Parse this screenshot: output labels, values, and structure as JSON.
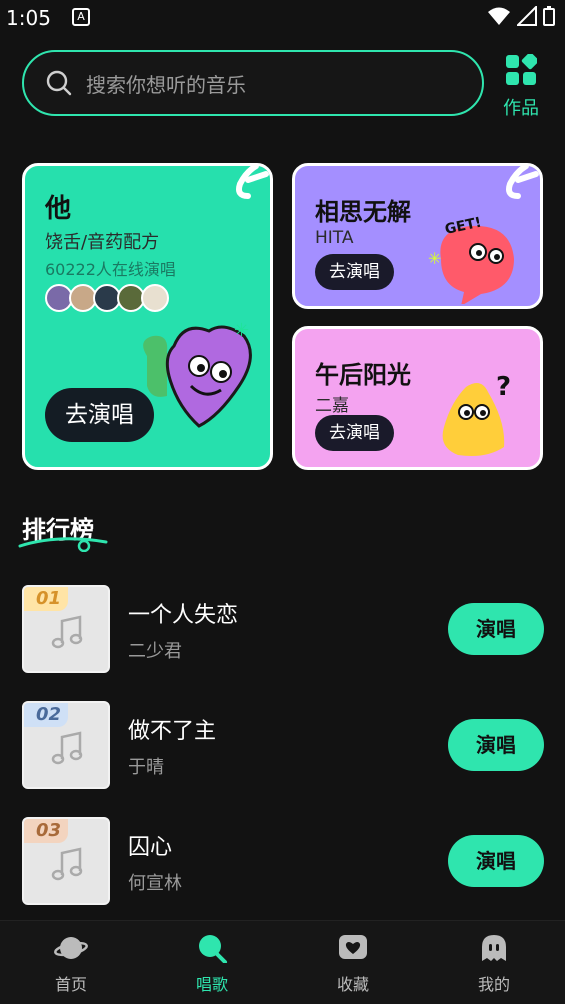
{
  "status": {
    "time": "1:05",
    "badge": "A"
  },
  "search": {
    "placeholder": "搜索你想听的音乐"
  },
  "works": {
    "label": "作品"
  },
  "featured": {
    "big": {
      "title": "他",
      "artist": "饶舌/音药配方",
      "online": "60222人在线演唱",
      "button": "去演唱"
    },
    "purple": {
      "title": "相思无解",
      "artist": "HITA",
      "button": "去演唱"
    },
    "pink": {
      "title": "午后阳光",
      "artist": "二嘉",
      "button": "去演唱"
    }
  },
  "ranking": {
    "title": "排行榜",
    "items": [
      {
        "rank": "01",
        "name": "一个人失恋",
        "artist": "二少君",
        "button": "演唱"
      },
      {
        "rank": "02",
        "name": "做不了主",
        "artist": "于晴",
        "button": "演唱"
      },
      {
        "rank": "03",
        "name": "囚心",
        "artist": "何宣林",
        "button": "演唱"
      }
    ]
  },
  "tabs": [
    {
      "label": "首页",
      "icon": "planet-icon"
    },
    {
      "label": "唱歌",
      "icon": "microphone-icon",
      "active": true
    },
    {
      "label": "收藏",
      "icon": "heart-icon"
    },
    {
      "label": "我的",
      "icon": "ghost-icon"
    }
  ],
  "colors": {
    "accent": "#2fe5ae",
    "background": "#121212",
    "card_green": "#26e0ad",
    "card_purple": "#a48fff",
    "card_pink": "#f4a3f0"
  }
}
